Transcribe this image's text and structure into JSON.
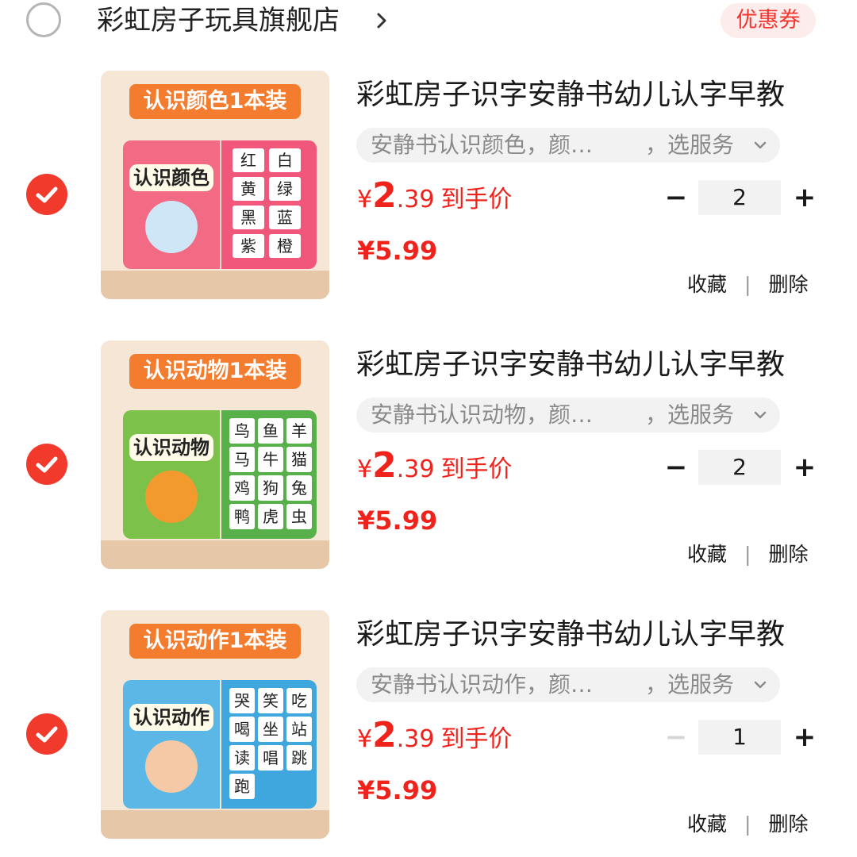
{
  "store": {
    "name": "彩虹房子玩具旗舰店",
    "chevron": "›",
    "coupon_label": "优惠券",
    "selected": false
  },
  "items": [
    {
      "selected": true,
      "thumb_banner": "认识颜色1本装",
      "book_title": "认识颜色",
      "cover_color": "#f26a84",
      "page_color": "#f0577a",
      "chars": [
        "红",
        "白",
        "黄",
        "绿",
        "黑",
        "蓝",
        "紫",
        "橙"
      ],
      "title": "彩虹房子识字安静书幼儿认字早教",
      "sku_text": "安静书认识颜色，颜…",
      "sku_service": "，选服务",
      "price_symbol": "¥",
      "price_int": "2",
      "price_dec": ".39",
      "price_tag": "到手价",
      "quantity": "2",
      "minus_enabled": true,
      "orig_price": "¥5.99",
      "fav_label": "收藏",
      "separator": "|",
      "delete_label": "删除"
    },
    {
      "selected": true,
      "thumb_banner": "认识动物1本装",
      "book_title": "认识动物",
      "cover_color": "#7cc24a",
      "page_color": "#58b04a",
      "chars": [
        "鸟",
        "鱼",
        "羊",
        "马",
        "牛",
        "猫",
        "鸡",
        "狗",
        "兔",
        "鸭",
        "虎",
        "虫"
      ],
      "title": "彩虹房子识字安静书幼儿认字早教",
      "sku_text": "安静书认识动物，颜…",
      "sku_service": "，选服务",
      "price_symbol": "¥",
      "price_int": "2",
      "price_dec": ".39",
      "price_tag": "到手价",
      "quantity": "2",
      "minus_enabled": true,
      "orig_price": "¥5.99",
      "fav_label": "收藏",
      "separator": "|",
      "delete_label": "删除"
    },
    {
      "selected": true,
      "thumb_banner": "认识动作1本装",
      "book_title": "认识动作",
      "cover_color": "#5bb8e6",
      "page_color": "#3fa6de",
      "chars": [
        "哭",
        "笑",
        "吃",
        "喝",
        "坐",
        "站",
        "读",
        "唱",
        "跳",
        "跑"
      ],
      "title": "彩虹房子识字安静书幼儿认字早教",
      "sku_text": "安静书认识动作，颜…",
      "sku_service": "，选服务",
      "price_symbol": "¥",
      "price_int": "2",
      "price_dec": ".39",
      "price_tag": "到手价",
      "quantity": "1",
      "minus_enabled": false,
      "orig_price": "¥5.99",
      "fav_label": "收藏",
      "separator": "|",
      "delete_label": "删除"
    }
  ],
  "icons": {
    "check": "check-icon",
    "chevron_down": "chevron-down-icon",
    "minus": "−",
    "plus": "+"
  },
  "colors": {
    "accent": "#f23a2c",
    "price": "#f0231c",
    "coupon_bg": "#fdecec"
  }
}
